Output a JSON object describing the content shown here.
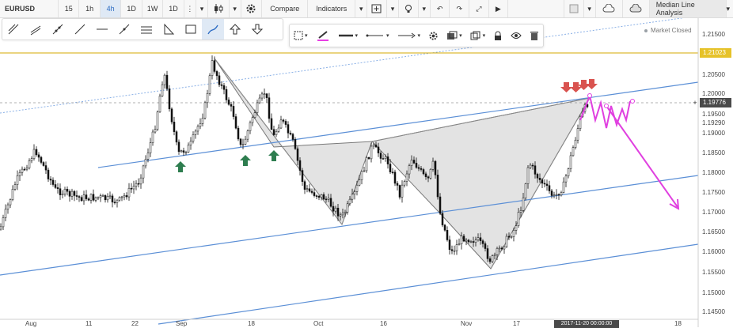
{
  "toolbar": {
    "symbol": "EURUSD",
    "intervals": [
      "15",
      "1h",
      "4h",
      "1D",
      "1W",
      "1D"
    ],
    "active_interval": "4h",
    "compare_label": "Compare",
    "indicators_label": "Indicators",
    "panel_title": "Median Line Analysis"
  },
  "drawing_tools": [
    "trendline-angle-icon",
    "channel-icon",
    "ray-icon",
    "segment-icon",
    "horizontal-line-icon",
    "pitchfork-icon",
    "parallel-lines-icon",
    "triangle-icon",
    "rectangle-icon",
    "brush-icon",
    "arrow-up-icon",
    "arrow-down-icon"
  ],
  "selected_drawing_tool": "brush-icon",
  "properties_toolbar": {
    "line_color": "#e83fe4"
  },
  "market_status": "Market Closed",
  "price_axis": {
    "labels": [
      "1.21500",
      "1.20500",
      "1.20000",
      "1.19500",
      "1.19000",
      "1.18500",
      "1.18000",
      "1.17500",
      "1.17000",
      "1.16500",
      "1.16000",
      "1.15500",
      "1.15000",
      "1.14500"
    ],
    "highlight_gold": "1.21023",
    "current_price": "1.19776",
    "price_1195": "1.19500",
    "price_1193": "1.19290"
  },
  "time_axis": {
    "labels": [
      "Aug",
      "11",
      "22",
      "Sep",
      "18",
      "Oct",
      "16",
      "Nov",
      "17",
      "18"
    ],
    "current_date_badge": "2017-11-20 00:00:00"
  },
  "colors": {
    "channel": "#5b8fd6",
    "harmonic_fill": "#d9d9d9",
    "projection": "#e040e0",
    "arrow_down": "#d9534f",
    "arrow_up": "#2e7d4f",
    "gold_line": "#d4aa00"
  }
}
